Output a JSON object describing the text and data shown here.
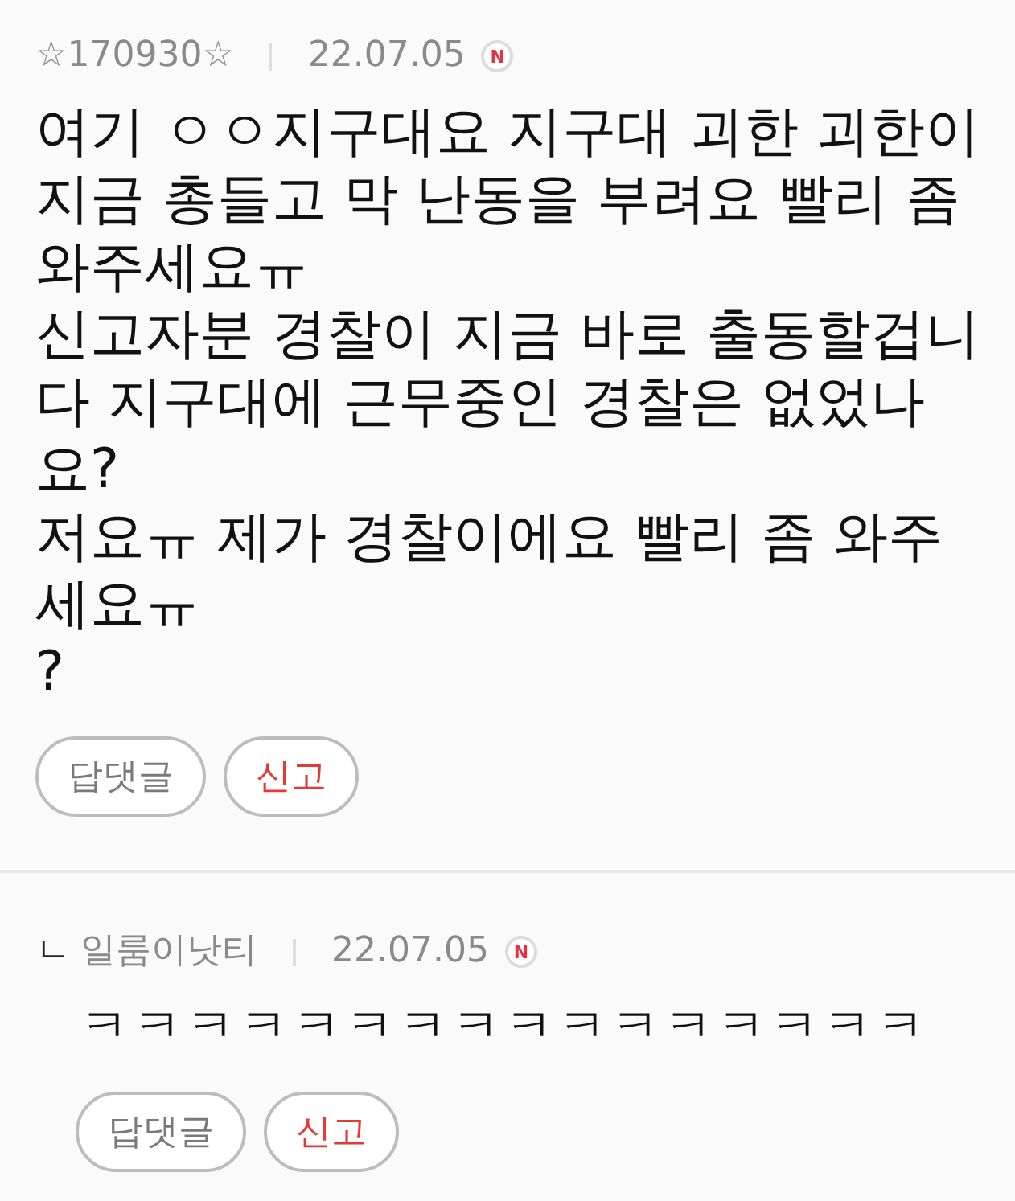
{
  "comments": [
    {
      "kind": "comment",
      "author": "☆170930☆",
      "date": "22.07.05",
      "badge": "N",
      "lines": [
        "여기 ㅇㅇ지구대요 지구대 괴한 괴한이 지금 총들고 막 난동을 부려요 빨리 좀 와주세요ㅠ",
        "신고자분 경찰이 지금 바로 출동할겁니다 지구대에 근무중인 경찰은 없었나요?",
        "저요ㅠ 제가 경찰이에요 빨리 좀 와주세요ㅠ",
        "?"
      ],
      "buttons": [
        {
          "kind": "reply",
          "label": "답댓글"
        },
        {
          "kind": "report",
          "label": "신고"
        }
      ]
    },
    {
      "kind": "reply",
      "marker": "ㄴ",
      "author": "일룸이낫티",
      "date": "22.07.05",
      "badge": "N",
      "lines": [
        "ㅋㅋㅋㅋㅋㅋㅋㅋㅋㅋㅋㅋㅋㅋㅋㅋ"
      ],
      "buttons": [
        {
          "kind": "reply",
          "label": "답댓글"
        },
        {
          "kind": "report",
          "label": "신고"
        }
      ]
    }
  ]
}
